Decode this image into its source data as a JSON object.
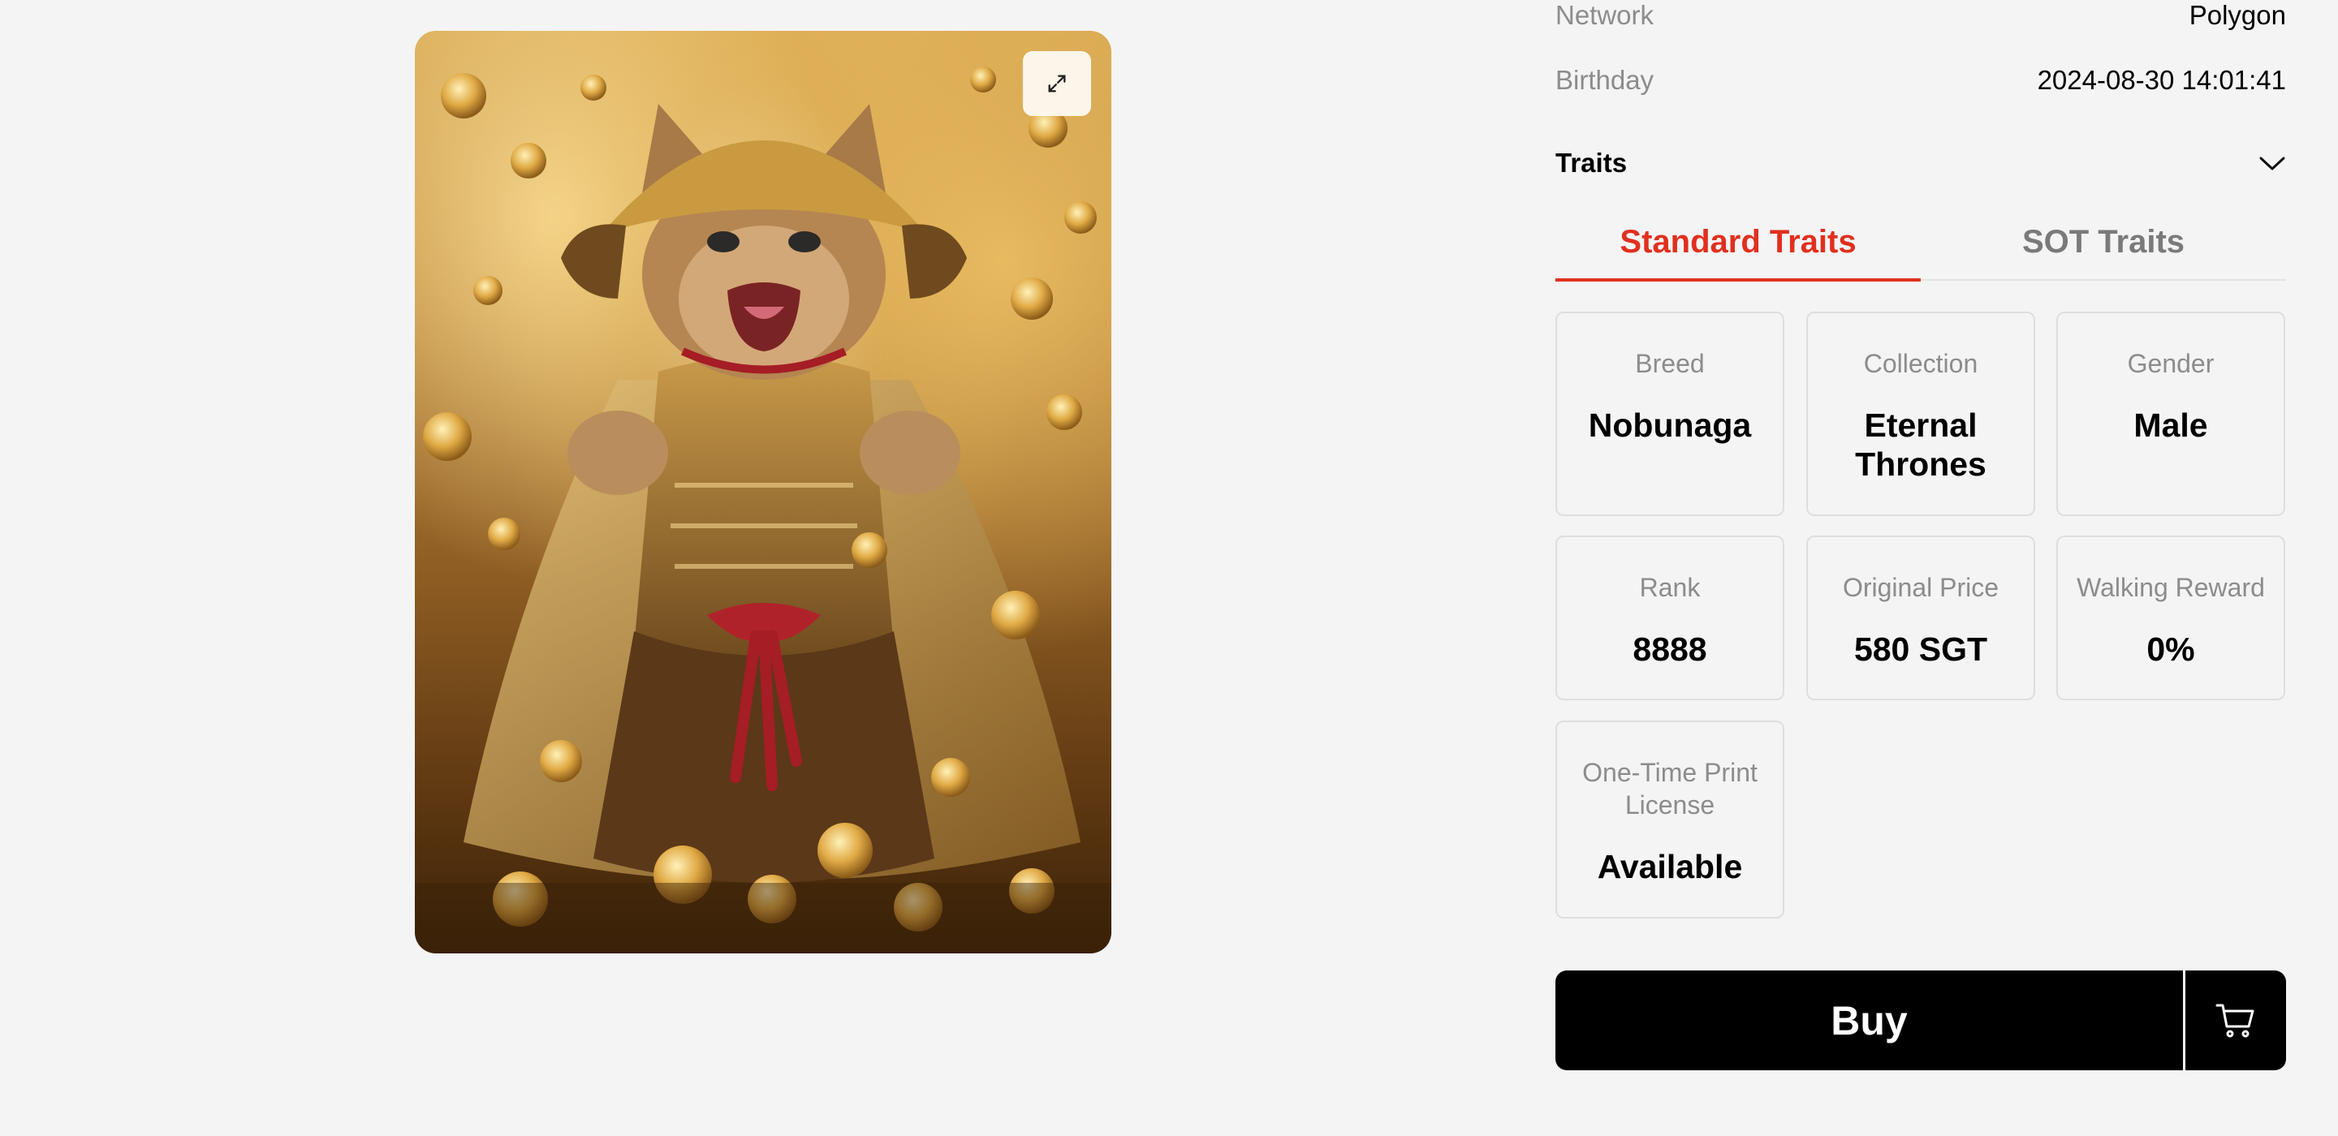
{
  "artwork": {
    "description_icon": "samurai-cat-nft-image",
    "expand_icon": "expand-icon"
  },
  "details": {
    "network_label": "Network",
    "network_value": "Polygon",
    "birthday_label": "Birthday",
    "birthday_value": "2024-08-30 14:01:41"
  },
  "traits": {
    "title": "Traits",
    "toggle_icon": "chevron-down-icon",
    "tabs": [
      {
        "label": "Standard Traits",
        "active": true
      },
      {
        "label": "SOT Traits",
        "active": false
      }
    ],
    "items": [
      {
        "label": "Breed",
        "value": "Nobunaga"
      },
      {
        "label": "Collection",
        "value": "Eternal Thrones"
      },
      {
        "label": "Gender",
        "value": "Male"
      },
      {
        "label": "Rank",
        "value": "8888"
      },
      {
        "label": "Original Price",
        "value": "580 SGT"
      },
      {
        "label": "Walking Reward",
        "value": "0%"
      },
      {
        "label": "One-Time Print License",
        "value": "Available"
      }
    ]
  },
  "actions": {
    "buy_label": "Buy",
    "cart_icon": "cart-icon"
  },
  "colors": {
    "accent": "#e0301e",
    "background": "#f4f4f4",
    "button": "#000000"
  }
}
